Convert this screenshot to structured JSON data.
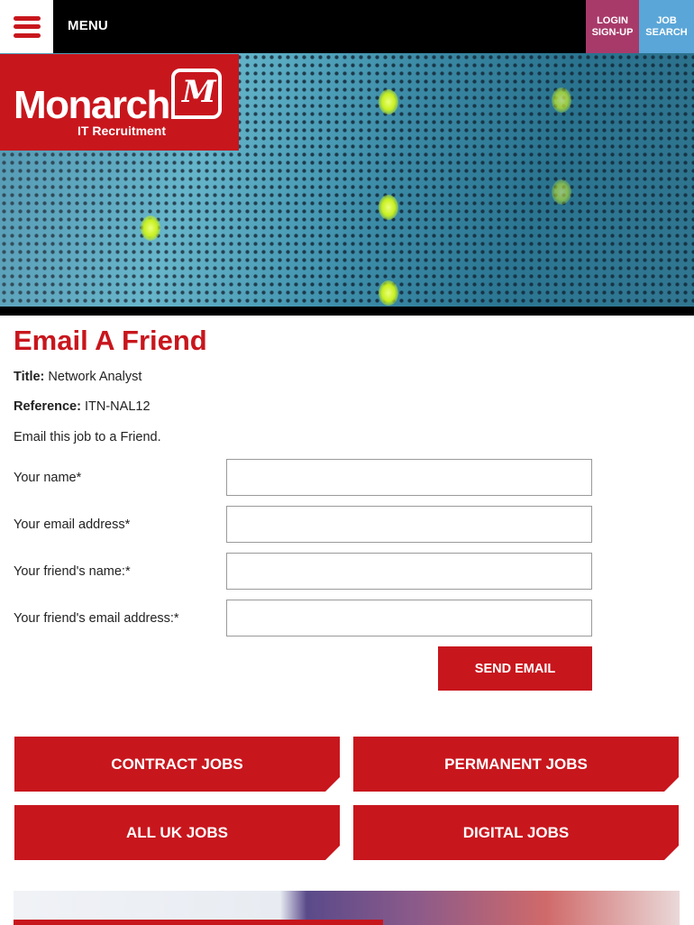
{
  "header": {
    "menu_label": "MENU",
    "login_line1": "LOGIN",
    "login_line2": "SIGN-UP",
    "jobsearch_line1": "JOB",
    "jobsearch_line2": "SEARCH"
  },
  "logo": {
    "word": "Monarch",
    "sub": "IT Recruitment",
    "mark": "M"
  },
  "colors": {
    "brand_red": "#c8161d",
    "login_bg": "#a83a6a",
    "jobsearch_bg": "#5aa6d8"
  },
  "main": {
    "title": "Email A Friend",
    "job_title_label": "Title:",
    "job_title_value": "Network Analyst",
    "reference_label": "Reference:",
    "reference_value": "ITN-NAL12",
    "intro": "Email this job to a Friend."
  },
  "form": {
    "your_name_label": "Your name*",
    "your_name_value": "",
    "your_email_label": "Your email address*",
    "your_email_value": "",
    "friend_name_label": "Your friend's name:*",
    "friend_name_value": "",
    "friend_email_label": "Your friend's email address:*",
    "friend_email_value": "",
    "send_label": "SEND EMAIL"
  },
  "categories": {
    "contract": "CONTRACT JOBS",
    "permanent": "PERMANENT JOBS",
    "all_uk": "ALL UK JOBS",
    "digital": "DIGITAL JOBS"
  },
  "icons": [
    "hamburger-menu-icon"
  ]
}
